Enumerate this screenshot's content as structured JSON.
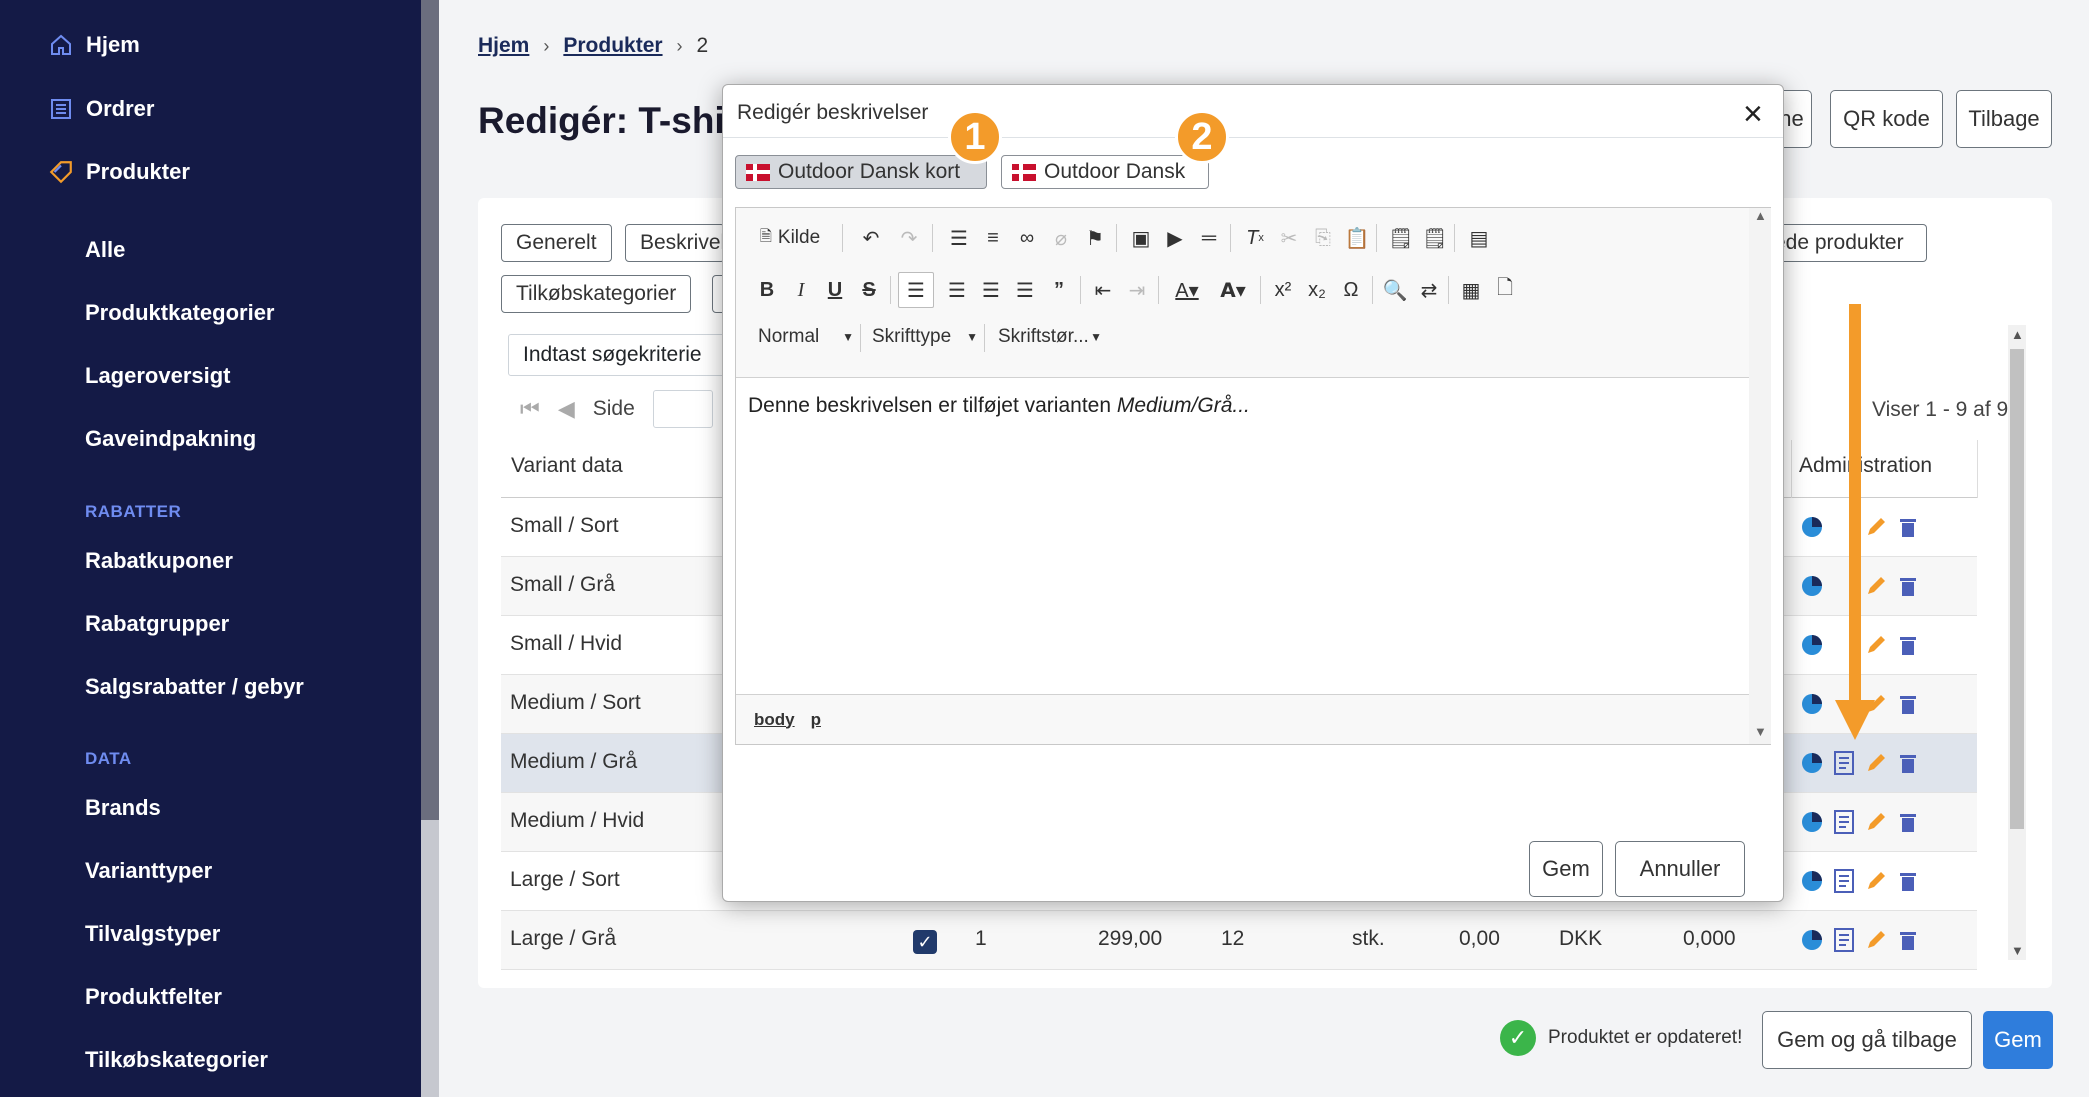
{
  "sidebar": {
    "main_items": [
      {
        "label": "Hjem",
        "icon": "home-icon"
      },
      {
        "label": "Ordrer",
        "icon": "list-icon"
      },
      {
        "label": "Produkter",
        "icon": "tag-icon"
      }
    ],
    "product_items": [
      "Alle",
      "Produktkategorier",
      "Lageroversigt",
      "Gaveindpakning"
    ],
    "section_rabatter": "RABATTER",
    "rabatter_items": [
      "Rabatkuponer",
      "Rabatgrupper",
      "Salgsrabatter / gebyr"
    ],
    "section_data": "DATA",
    "data_items": [
      "Brands",
      "Varianttyper",
      "Tilvalgstyper",
      "Produktfelter",
      "Tilkøbskategorier"
    ]
  },
  "breadcrumb": {
    "home": "Hjem",
    "products": "Produkter",
    "current": "2"
  },
  "page_title": "Redigér: T-shi",
  "header_buttons": {
    "partial": "ne",
    "qr": "QR kode",
    "back": "Tilbage"
  },
  "tabs": {
    "general": "Generelt",
    "descriptions": "Beskrivel",
    "addon_categories": "Tilkøbskategorier",
    "related_partial": "ede produkter"
  },
  "search": {
    "placeholder": "Indtast søgekriterie"
  },
  "pager": {
    "page_label": "Side",
    "showing": "Viser 1 - 9 af 9"
  },
  "table": {
    "headers": {
      "variant_data": "Variant data",
      "administration": "Administration"
    },
    "rows": [
      {
        "variant": "Small / Sort"
      },
      {
        "variant": "Small / Grå"
      },
      {
        "variant": "Small / Hvid"
      },
      {
        "variant": "Medium / Sort"
      },
      {
        "variant": "Medium / Grå"
      },
      {
        "variant": "Medium / Hvid"
      },
      {
        "variant": "Large / Sort"
      },
      {
        "variant": "Large / Grå",
        "checked": true,
        "qty": "1",
        "price": "299,00",
        "stock": "12",
        "unit": "stk.",
        "discount": "0,00",
        "currency": "DKK",
        "weight": "0,000"
      }
    ]
  },
  "footer": {
    "status": "Produktet er opdateret!",
    "save_back": "Gem og gå tilbage",
    "save": "Gem"
  },
  "modal": {
    "title": "Redigér beskrivelser",
    "lang_tabs": [
      "Outdoor Dansk kort",
      "Outdoor Dansk"
    ],
    "badges": [
      "1",
      "2"
    ],
    "toolbar": {
      "source": "Kilde",
      "format": "Normal",
      "font": "Skrifttype",
      "size": "Skriftstør..."
    },
    "content_prefix": "Denne beskrivelsen er tilføjet varianten ",
    "content_italic": "Medium/Grå...",
    "path": [
      "body",
      "p"
    ],
    "save": "Gem",
    "cancel": "Annuller"
  },
  "colors": {
    "sidebar": "#141a46",
    "accent": "#f39b2a",
    "primary": "#2f7ddc",
    "success": "#3bb54a"
  }
}
